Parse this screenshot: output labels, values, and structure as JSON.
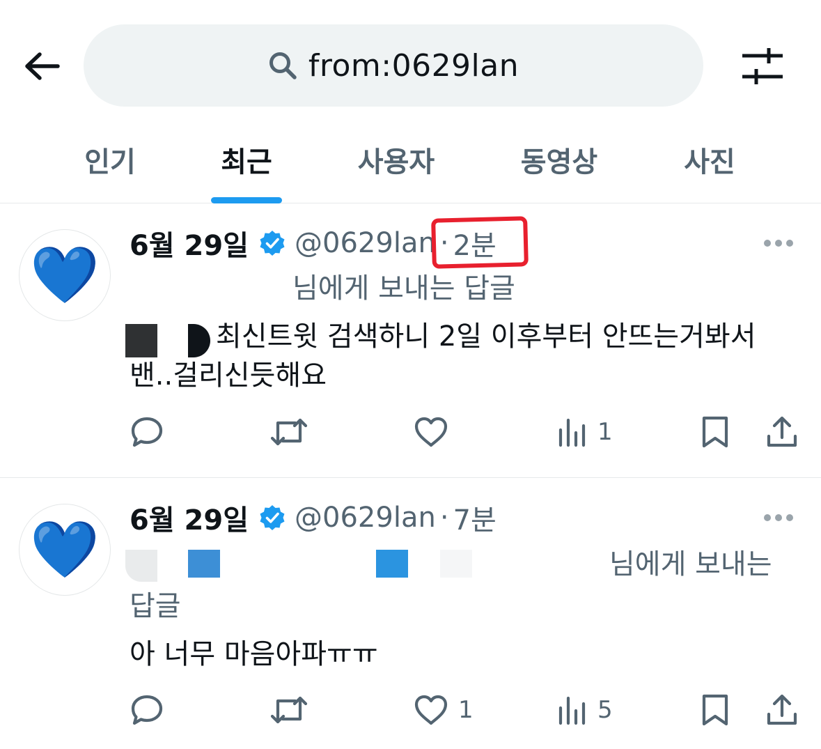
{
  "search": {
    "query": "from:0629lan"
  },
  "tabs": [
    {
      "label": "인기"
    },
    {
      "label": "최근"
    },
    {
      "label": "사용자"
    },
    {
      "label": "동영상"
    },
    {
      "label": "사진"
    }
  ],
  "active_tab": "최근",
  "tweets": [
    {
      "name": "6월 29일",
      "handle": "@0629lan",
      "separator": "·",
      "time": "2분",
      "reply_to_visible": "님에게 보내는 답글",
      "text_line1": "최신트윗 검색하니 2일 이후부터 안뜨는거봐서",
      "text_line2": "밴..걸리신듯해요",
      "counts": {
        "reply": "",
        "retweet": "",
        "like": "",
        "views": "1"
      }
    },
    {
      "name": "6월 29일",
      "handle": "@0629lan",
      "separator": "·",
      "time": "7분",
      "reply_to_visible": "님에게 보내는",
      "reply_to_line2": "답글",
      "text_line1": "아 너무 마음아파ㅠㅠ",
      "counts": {
        "reply": "",
        "retweet": "",
        "like": "1",
        "views": "5"
      }
    }
  ],
  "colors": {
    "accent": "#1d9bf0",
    "text": "#0f1419",
    "muted": "#536471",
    "highlight": "#e8202e",
    "search_bg": "#eff3f4"
  },
  "icons": [
    "back-arrow-icon",
    "search-icon",
    "filter-icon",
    "verified-badge-icon",
    "more-icon",
    "reply-icon",
    "retweet-icon",
    "like-icon",
    "views-icon",
    "bookmark-icon",
    "share-icon"
  ]
}
